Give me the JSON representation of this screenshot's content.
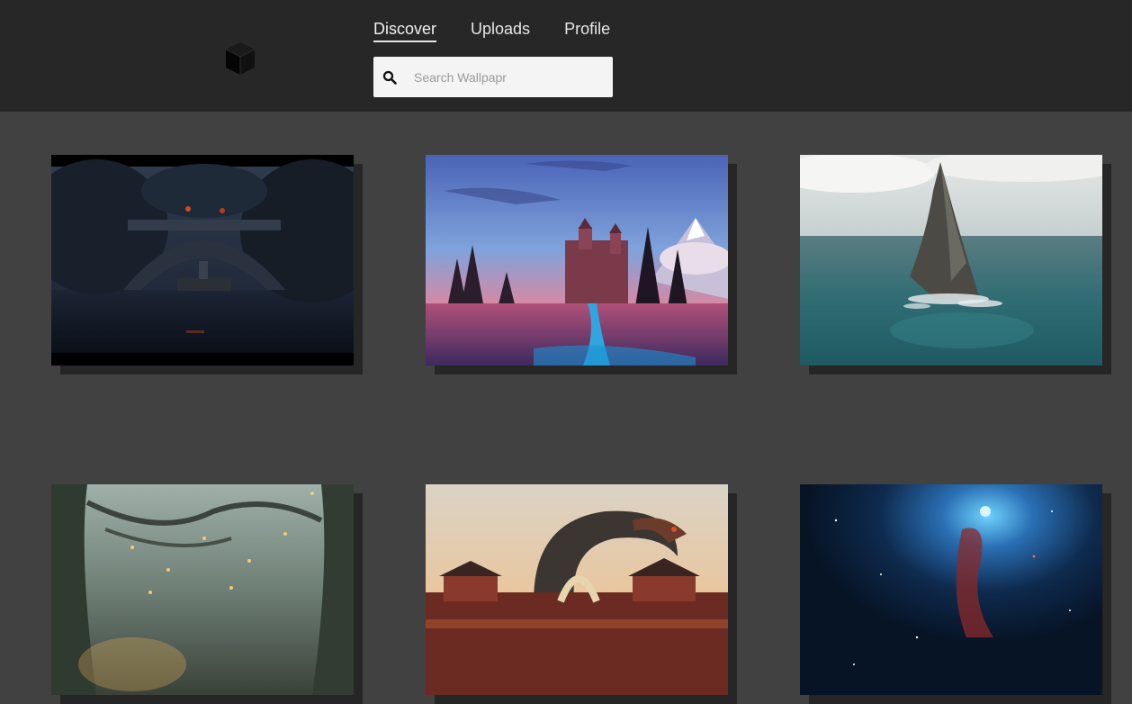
{
  "header": {
    "logo_icon": "cube-icon",
    "nav": [
      {
        "label": "Discover",
        "active": true
      },
      {
        "label": "Uploads",
        "active": false
      },
      {
        "label": "Profile",
        "active": false
      }
    ],
    "search": {
      "placeholder": "Search Wallpapr",
      "value": "",
      "icon": "search-icon"
    }
  },
  "wallpapers": [
    {
      "name": "dark-bridge-river"
    },
    {
      "name": "castle-sunset"
    },
    {
      "name": "sea-rock-spire"
    },
    {
      "name": "misty-forest-lanterns"
    },
    {
      "name": "dragon-pagoda-city"
    },
    {
      "name": "blue-nebula"
    }
  ],
  "colors": {
    "header_bg": "#272727",
    "page_bg": "#414141",
    "card_shadow": "#262626"
  }
}
